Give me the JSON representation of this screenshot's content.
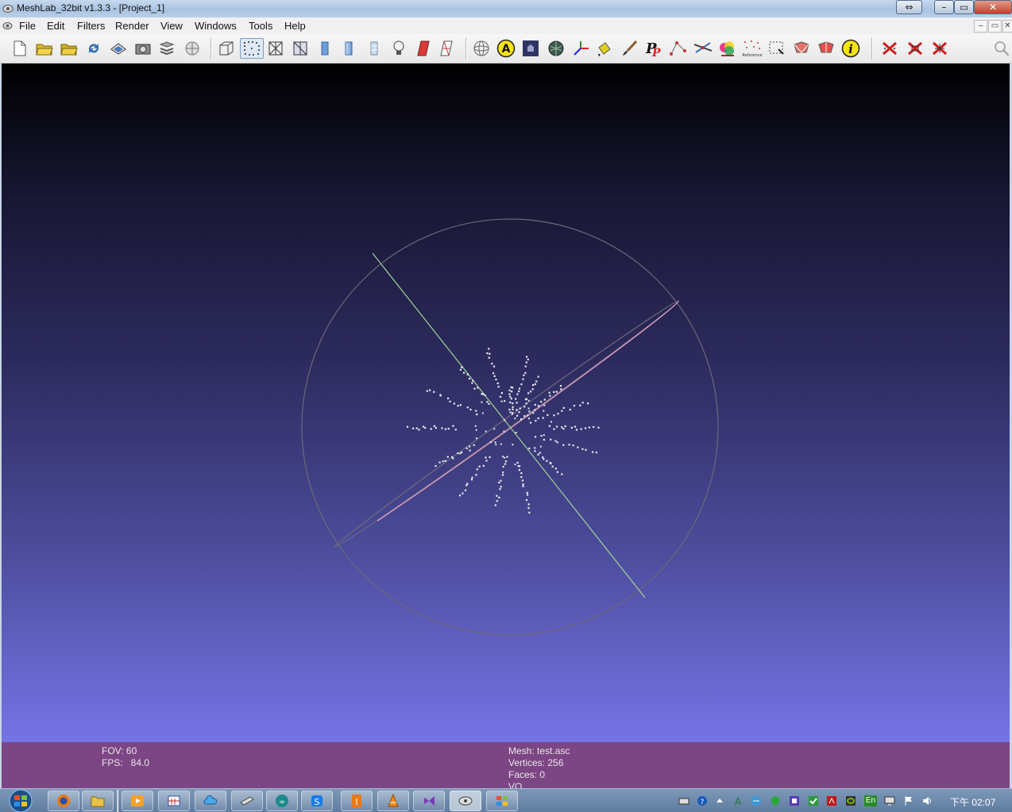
{
  "window": {
    "title": "MeshLab_32bit v1.3.3 - [Project_1]",
    "resize_glyph": "⇔",
    "min_glyph": "–",
    "max_glyph": "▭",
    "close_glyph": "✕"
  },
  "menu": {
    "items": [
      "File",
      "Edit",
      "Filters",
      "Render",
      "View",
      "Windows",
      "Tools",
      "Help"
    ],
    "mdi_min": "–",
    "mdi_restore": "▭",
    "mdi_close": "✕"
  },
  "toolbar": {
    "icons": [
      "new-project-icon",
      "open-project-icon",
      "open-mesh-icon",
      "reload-icon",
      "export-icon",
      "snapshot-icon",
      "layers-icon",
      "raster-icon",
      "bbox-icon",
      "points-icon",
      "wireframe-icon",
      "hiddenlines-icon",
      "flat-icon",
      "smooth-icon",
      "texture-icon",
      "light-icon",
      "backface-icon",
      "selected-faces-icon",
      "trackball-icon",
      "annotation-icon",
      "image-icon",
      "sphere-icon",
      "axis-icon",
      "paint-bucket-icon",
      "brush-icon",
      "pp-icon",
      "select-vertex-icon",
      "measure-icon",
      "color-paint-icon",
      "reference-icon",
      "select-region-icon",
      "select-faces-icon",
      "select-connected-icon",
      "info-icon",
      "delete-vertices-icon",
      "delete-faces-icon",
      "delete-all-icon",
      "search-icon"
    ],
    "annotation_letter": "A",
    "info_letter": "i",
    "pp_letter": "P",
    "reference_label": "Reference"
  },
  "viewport": {
    "bg_top": "#000000",
    "bg_bottom": "#7574e6",
    "axis_green": "#9fd49a",
    "axis_pink": "#e8a6c7",
    "trackball_color": "#7d7a8a",
    "point_color": "#e8e8f0"
  },
  "info": {
    "fov": "FOV: 60",
    "fps": "FPS:   84.0",
    "mesh": "Mesh: test.asc",
    "vertices": "Vertices: 256",
    "faces": "Faces: 0",
    "vo": "VO"
  },
  "taskbar": {
    "apps": [
      "firefox-icon",
      "explorer-icon",
      "media-player-icon",
      "calendar-icon",
      "cloud-icon",
      "scanner-icon",
      "arduino-icon",
      "skype-icon",
      "editor-icon",
      "vlc-icon",
      "visual-studio-icon",
      "meshlab-icon",
      "windows-icon"
    ],
    "tray": [
      "keyboard-icon",
      "help-icon",
      "arrow-icon",
      "font-icon",
      "network-icon",
      "shield-icon",
      "app-icon",
      "check-icon",
      "acrobat-icon",
      "nvidia-icon",
      "lang-icon",
      "monitor-icon",
      "flag-icon",
      "volume-icon"
    ],
    "lang": "En",
    "clock": "下午 02:07"
  }
}
